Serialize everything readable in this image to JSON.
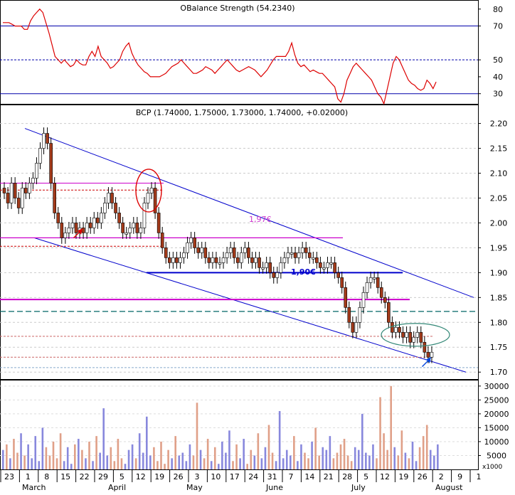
{
  "rsi_panel": {
    "title": "OBalance Strength (54.2340)",
    "ticks": [
      80,
      70,
      50,
      40,
      30
    ],
    "ylim": [
      24,
      82
    ],
    "levels": [
      70,
      50,
      30
    ]
  },
  "price_panel": {
    "title": "BCP (1.74000, 1.75000, 1.73000, 1.74000, +0.02000)",
    "ticks": [
      "2.20",
      "2.15",
      "2.10",
      "2.05",
      "2.00",
      "1.95",
      "1.90",
      "1.85",
      "1.80",
      "1.75",
      "1.70"
    ],
    "ylim": [
      1.686,
      2.238
    ],
    "annotations": [
      {
        "text": "1,97€",
        "color": "#cc33cc"
      },
      {
        "text": "1,90€",
        "color": "#0000cc"
      }
    ]
  },
  "volume_panel": {
    "ticks": [
      "30000",
      "25000",
      "20000",
      "15000",
      "10000",
      "5000"
    ],
    "unit_label": "x1000",
    "ylim": [
      0,
      32000
    ]
  },
  "x_axis": {
    "day_labels": [
      "23",
      "1",
      "8",
      "15",
      "22",
      "29",
      "5",
      "12",
      "19",
      "26",
      "3",
      "10",
      "17",
      "24",
      "31",
      "7",
      "14",
      "21",
      "28",
      "5",
      "12",
      "19",
      "26",
      "2",
      "9",
      "1"
    ],
    "months": [
      "March",
      "April",
      "May",
      "June",
      "July",
      "August"
    ]
  },
  "colors": {
    "up": "#ffffff",
    "down": "#a33a1a",
    "rsi_line": "#dd0000",
    "channel": "#0000cc",
    "magenta": "#cc00cc",
    "volume_up": "#8888dd",
    "volume_down": "#e0a088"
  },
  "chart_data": {
    "type": "candlestick",
    "title": "BCP (1.74000, 1.75000, 1.73000, 1.74000, +0.02000)",
    "price_ylim": [
      1.686,
      2.238
    ],
    "rsi_ylim": [
      24,
      82
    ],
    "volume_ylim": [
      0,
      32000
    ],
    "rsi": [
      72,
      72,
      72,
      71,
      70,
      70,
      70,
      68,
      68,
      73,
      76,
      78,
      80,
      78,
      72,
      66,
      59,
      52,
      50,
      48,
      50,
      48,
      46,
      47,
      50,
      48,
      47,
      47,
      52,
      55,
      52,
      58,
      52,
      50,
      48,
      45,
      46,
      48,
      50,
      55,
      58,
      60,
      54,
      50,
      47,
      45,
      43,
      42,
      40,
      40,
      40,
      40,
      41,
      42,
      44,
      46,
      47,
      48,
      50,
      48,
      46,
      44,
      42,
      42,
      43,
      44,
      46,
      45,
      44,
      42,
      44,
      46,
      48,
      50,
      48,
      46,
      44,
      43,
      44,
      45,
      46,
      45,
      44,
      42,
      40,
      42,
      44,
      47,
      50,
      52,
      52,
      52,
      52,
      55,
      60,
      53,
      48,
      46,
      47,
      45,
      43,
      44,
      43,
      42,
      42,
      40,
      38,
      36,
      34,
      27,
      25,
      30,
      38,
      42,
      46,
      48,
      46,
      44,
      42,
      40,
      38,
      34,
      30,
      28,
      24,
      32,
      40,
      48,
      52,
      50,
      46,
      42,
      38,
      36,
      35,
      33,
      32,
      33,
      38,
      36,
      33,
      37
    ]
  }
}
